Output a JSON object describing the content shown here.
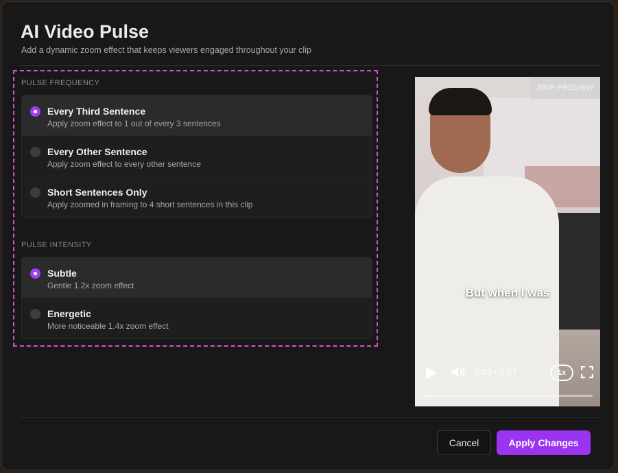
{
  "dialog": {
    "title": "AI Video Pulse",
    "subtitle": "Add a dynamic zoom effect that keeps viewers engaged throughout your clip"
  },
  "frequency": {
    "label": "PULSE FREQUENCY",
    "options": [
      {
        "title": "Every Third Sentence",
        "desc": "Apply zoom effect to 1 out of every 3 sentences",
        "selected": true
      },
      {
        "title": "Every Other Sentence",
        "desc": "Apply zoom effect to every other sentence",
        "selected": false
      },
      {
        "title": "Short Sentences Only",
        "desc": "Apply zoomed in framing to 4 short sentences in this clip",
        "selected": false
      }
    ]
  },
  "intensity": {
    "label": "PULSE INTENSITY",
    "options": [
      {
        "title": "Subtle",
        "desc": "Gentle 1.2x zoom effect",
        "selected": true
      },
      {
        "title": "Energetic",
        "desc": "More noticeable 1.4x zoom effect",
        "selected": false
      }
    ]
  },
  "preview": {
    "badge": "360P PREVIEW",
    "caption": "But when I was",
    "time": "0:00 / 0:57",
    "speed": "1x",
    "progress": 0.01
  },
  "buttons": {
    "cancel": "Cancel",
    "apply": "Apply Changes"
  },
  "colors": {
    "accent": "#9a34f0",
    "highlight_border": "#d54fd3",
    "background": "#181818"
  }
}
